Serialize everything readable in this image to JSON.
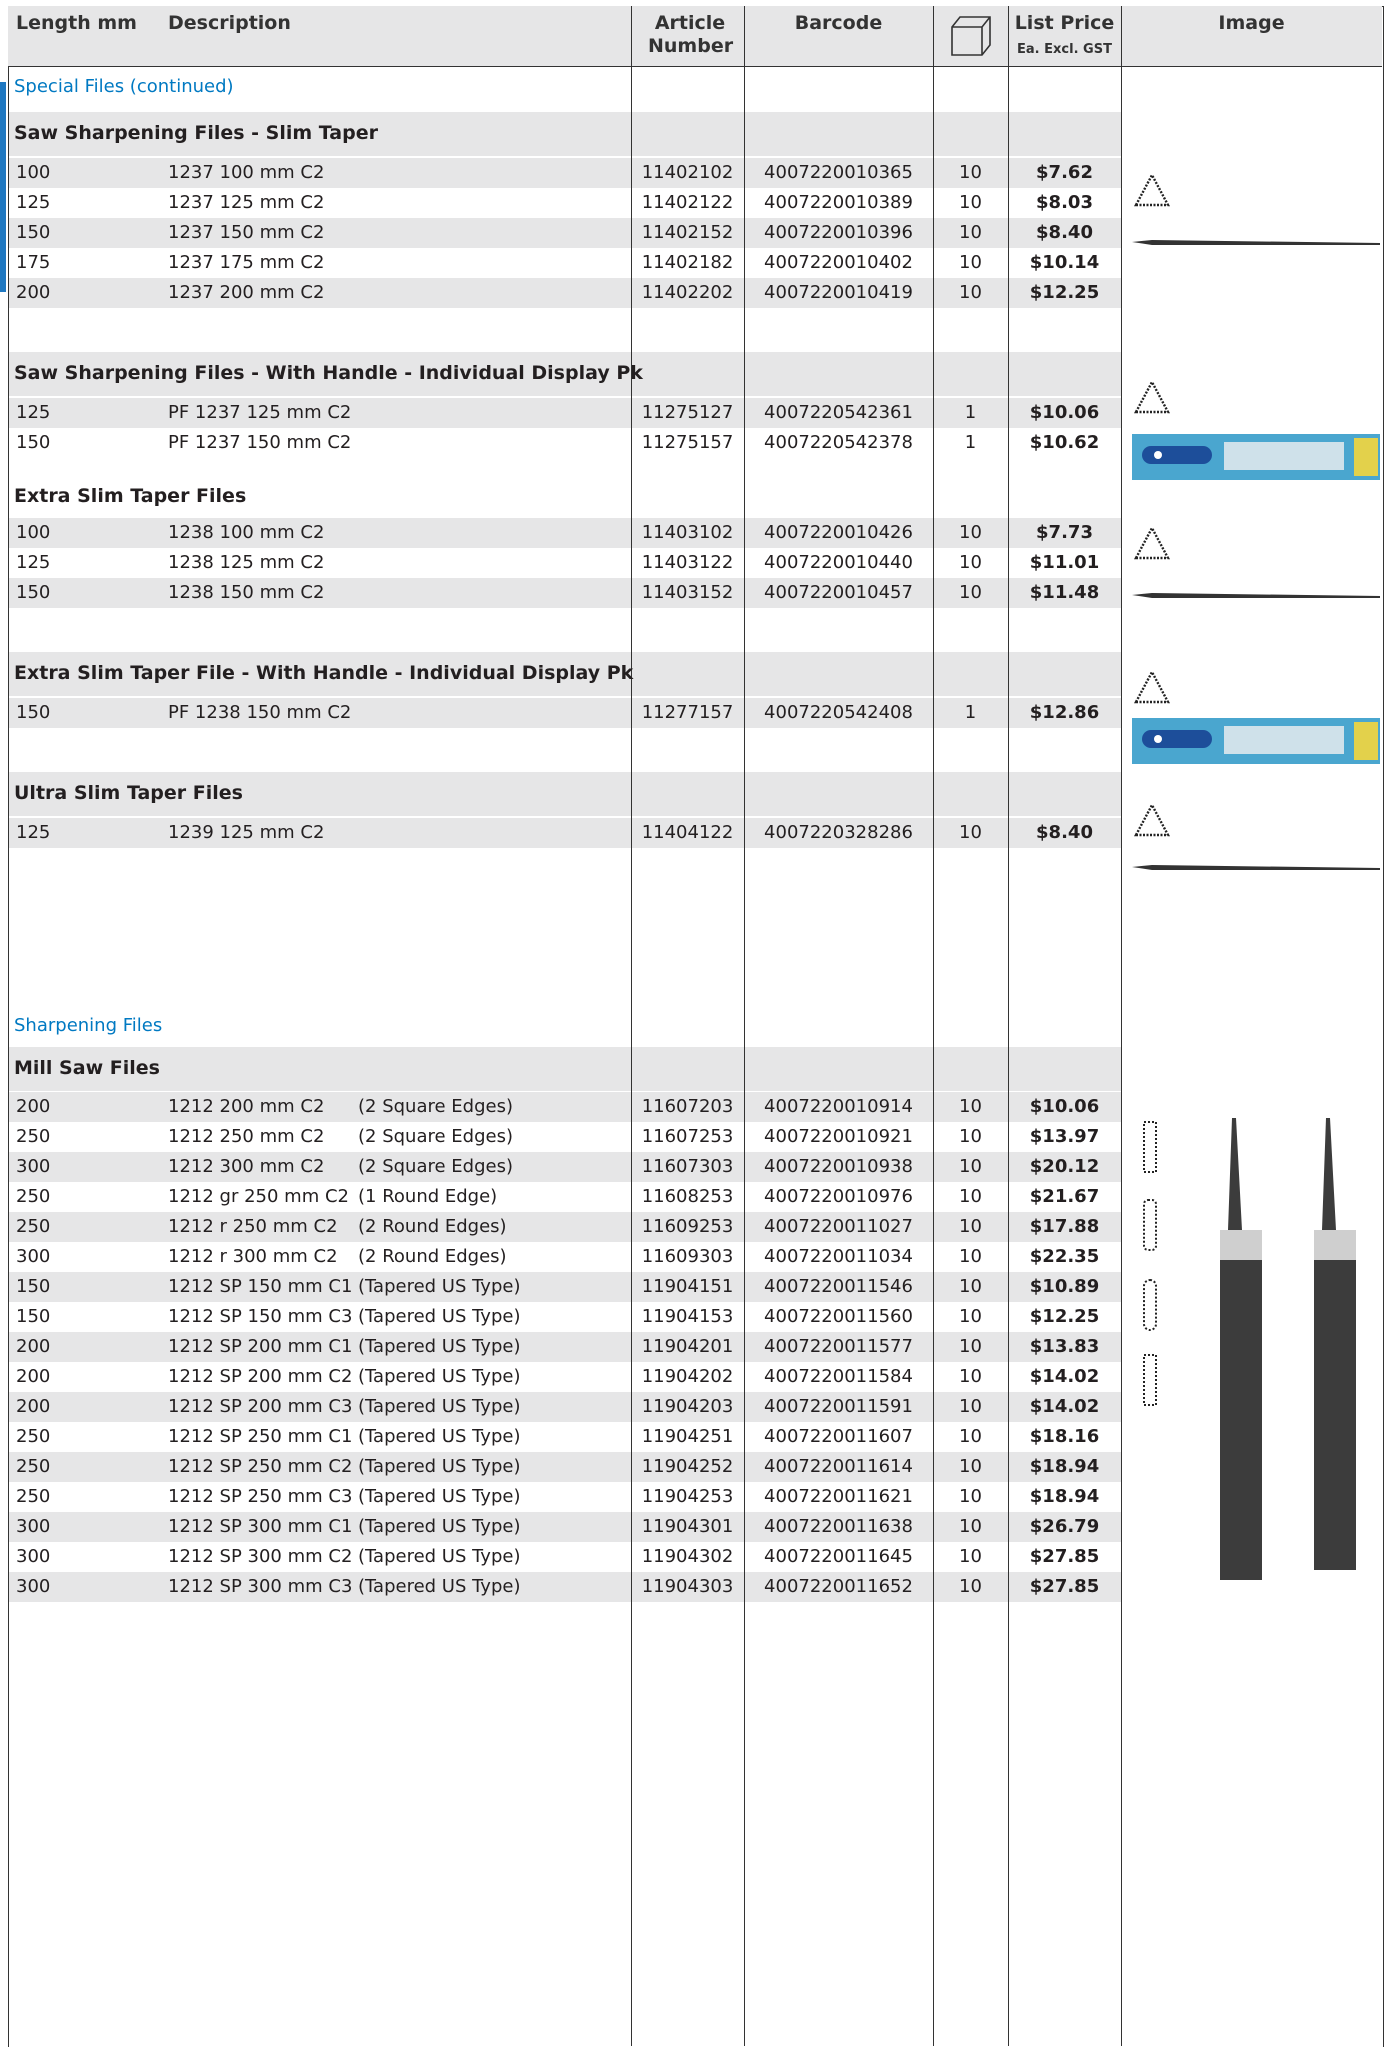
{
  "header": {
    "length": "Length mm",
    "description": "Description",
    "article": "Article Number",
    "barcode": "Barcode",
    "box_icon": "box-icon",
    "price": "List Price",
    "price_sub": "Ea. Excl. GST",
    "image": "Image"
  },
  "sections": [
    {
      "label": "Special Files (continued)",
      "kind": "category"
    },
    {
      "label": "Saw Sharpening Files - Slim Taper",
      "kind": "group",
      "rows": [
        {
          "length": "100",
          "desc": "1237 100 mm C2",
          "note": "",
          "article": "11402102",
          "barcode": "4007220010365",
          "qty": "10",
          "price": "$7.62"
        },
        {
          "length": "125",
          "desc": "1237 125 mm C2",
          "note": "",
          "article": "11402122",
          "barcode": "4007220010389",
          "qty": "10",
          "price": "$8.03"
        },
        {
          "length": "150",
          "desc": "1237 150 mm C2",
          "note": "",
          "article": "11402152",
          "barcode": "4007220010396",
          "qty": "10",
          "price": "$8.40"
        },
        {
          "length": "175",
          "desc": "1237 175 mm C2",
          "note": "",
          "article": "11402182",
          "barcode": "4007220010402",
          "qty": "10",
          "price": "$10.14"
        },
        {
          "length": "200",
          "desc": "1237 200 mm C2",
          "note": "",
          "article": "11402202",
          "barcode": "4007220010419",
          "qty": "10",
          "price": "$12.25"
        }
      ]
    },
    {
      "label": "Saw Sharpening Files - With Handle - Individual Display Pk",
      "kind": "group",
      "rows": [
        {
          "length": "125",
          "desc": "PF 1237 125 mm C2",
          "note": "",
          "article": "11275127",
          "barcode": "4007220542361",
          "qty": "1",
          "price": "$10.06"
        },
        {
          "length": "150",
          "desc": "PF 1237 150 mm C2",
          "note": "",
          "article": "11275157",
          "barcode": "4007220542378",
          "qty": "1",
          "price": "$10.62"
        }
      ]
    },
    {
      "label": "Extra Slim Taper Files",
      "kind": "group",
      "rows": [
        {
          "length": "100",
          "desc": "1238 100 mm C2",
          "note": "",
          "article": "11403102",
          "barcode": "4007220010426",
          "qty": "10",
          "price": "$7.73"
        },
        {
          "length": "125",
          "desc": "1238 125 mm C2",
          "note": "",
          "article": "11403122",
          "barcode": "4007220010440",
          "qty": "10",
          "price": "$11.01"
        },
        {
          "length": "150",
          "desc": "1238 150 mm C2",
          "note": "",
          "article": "11403152",
          "barcode": "4007220010457",
          "qty": "10",
          "price": "$11.48"
        }
      ]
    },
    {
      "label": "Extra Slim Taper File - With Handle - Individual Display Pk",
      "kind": "group",
      "rows": [
        {
          "length": "150",
          "desc": "PF 1238 150 mm C2",
          "note": "",
          "article": "11277157",
          "barcode": "4007220542408",
          "qty": "1",
          "price": "$12.86"
        }
      ]
    },
    {
      "label": "Ultra Slim Taper Files",
      "kind": "group",
      "rows": [
        {
          "length": "125",
          "desc": "1239 125 mm C2",
          "note": "",
          "article": "11404122",
          "barcode": "4007220328286",
          "qty": "10",
          "price": "$8.40"
        }
      ]
    },
    {
      "label": "Sharpening Files",
      "kind": "category"
    },
    {
      "label": "Mill Saw Files",
      "kind": "group",
      "rows": [
        {
          "length": "200",
          "desc": "1212 200 mm C2",
          "note": "(2 Square Edges)",
          "article": "11607203",
          "barcode": "4007220010914",
          "qty": "10",
          "price": "$10.06"
        },
        {
          "length": "250",
          "desc": "1212 250 mm C2",
          "note": "(2 Square Edges)",
          "article": "11607253",
          "barcode": "4007220010921",
          "qty": "10",
          "price": "$13.97"
        },
        {
          "length": "300",
          "desc": "1212 300 mm C2",
          "note": "(2 Square Edges)",
          "article": "11607303",
          "barcode": "4007220010938",
          "qty": "10",
          "price": "$20.12"
        },
        {
          "length": "250",
          "desc": "1212 gr 250 mm C2",
          "note": "(1 Round Edge)",
          "article": "11608253",
          "barcode": "4007220010976",
          "qty": "10",
          "price": "$21.67"
        },
        {
          "length": "250",
          "desc": "1212 r 250 mm C2",
          "note": "(2 Round Edges)",
          "article": "11609253",
          "barcode": "4007220011027",
          "qty": "10",
          "price": "$17.88"
        },
        {
          "length": "300",
          "desc": "1212 r 300 mm C2",
          "note": "(2 Round Edges)",
          "article": "11609303",
          "barcode": "4007220011034",
          "qty": "10",
          "price": "$22.35"
        },
        {
          "length": "150",
          "desc": "1212 SP 150 mm C1",
          "note": "(Tapered US Type)",
          "article": "11904151",
          "barcode": "4007220011546",
          "qty": "10",
          "price": "$10.89"
        },
        {
          "length": "150",
          "desc": "1212 SP 150 mm C3",
          "note": "(Tapered US Type)",
          "article": "11904153",
          "barcode": "4007220011560",
          "qty": "10",
          "price": "$12.25"
        },
        {
          "length": "200",
          "desc": "1212 SP 200 mm C1",
          "note": "(Tapered US Type)",
          "article": "11904201",
          "barcode": "4007220011577",
          "qty": "10",
          "price": "$13.83"
        },
        {
          "length": "200",
          "desc": "1212 SP 200 mm C2",
          "note": "(Tapered US Type)",
          "article": "11904202",
          "barcode": "4007220011584",
          "qty": "10",
          "price": "$14.02"
        },
        {
          "length": "200",
          "desc": "1212 SP 200 mm C3",
          "note": "(Tapered US Type)",
          "article": "11904203",
          "barcode": "4007220011591",
          "qty": "10",
          "price": "$14.02"
        },
        {
          "length": "250",
          "desc": "1212 SP 250 mm C1",
          "note": "(Tapered US Type)",
          "article": "11904251",
          "barcode": "4007220011607",
          "qty": "10",
          "price": "$18.16"
        },
        {
          "length": "250",
          "desc": "1212 SP 250 mm C2",
          "note": "(Tapered US Type)",
          "article": "11904252",
          "barcode": "4007220011614",
          "qty": "10",
          "price": "$18.94"
        },
        {
          "length": "250",
          "desc": "1212 SP 250 mm C3",
          "note": "(Tapered US Type)",
          "article": "11904253",
          "barcode": "4007220011621",
          "qty": "10",
          "price": "$18.94"
        },
        {
          "length": "300",
          "desc": "1212 SP 300 mm C1",
          "note": "(Tapered US Type)",
          "article": "11904301",
          "barcode": "4007220011638",
          "qty": "10",
          "price": "$26.79"
        },
        {
          "length": "300",
          "desc": "1212 SP 300 mm C2",
          "note": "(Tapered US Type)",
          "article": "11904302",
          "barcode": "4007220011645",
          "qty": "10",
          "price": "$27.85"
        },
        {
          "length": "300",
          "desc": "1212 SP 300 mm C3",
          "note": "(Tapered US Type)",
          "article": "11904303",
          "barcode": "4007220011652",
          "qty": "10",
          "price": "$27.85"
        }
      ]
    }
  ],
  "colors": {
    "accent": "#0079c2",
    "band": "#e6e6e7",
    "rule": "#333333"
  }
}
